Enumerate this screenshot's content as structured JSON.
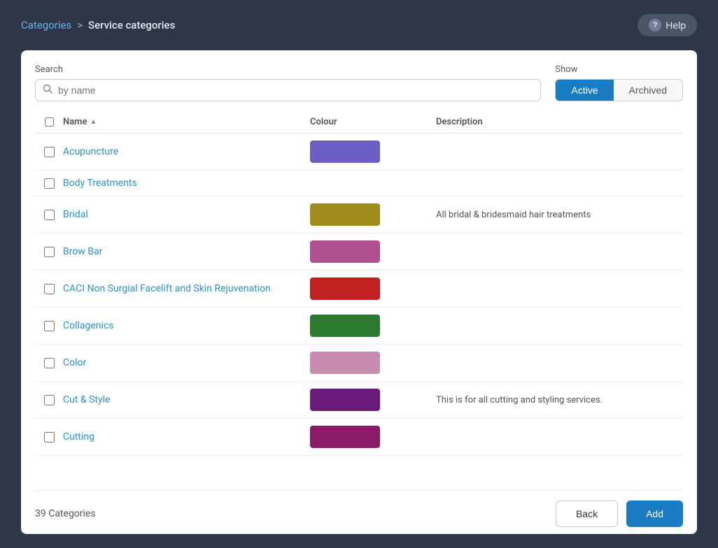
{
  "breadcrumb": {
    "parent_label": "Categories",
    "separator": ">",
    "current_label": "Service categories"
  },
  "help_button": {
    "label": "Help",
    "icon": "?"
  },
  "search": {
    "label": "Search",
    "placeholder": "by name"
  },
  "show": {
    "label": "Show",
    "options": [
      {
        "id": "active",
        "label": "Active",
        "active": true
      },
      {
        "id": "archived",
        "label": "Archived",
        "active": false
      }
    ]
  },
  "table": {
    "columns": [
      {
        "id": "check",
        "label": ""
      },
      {
        "id": "name",
        "label": "Name"
      },
      {
        "id": "colour",
        "label": "Colour"
      },
      {
        "id": "description",
        "label": "Description"
      }
    ],
    "rows": [
      {
        "id": 1,
        "name": "Acupuncture",
        "color": "#6b5fc4",
        "description": ""
      },
      {
        "id": 2,
        "name": "Body Treatments",
        "color": "",
        "description": ""
      },
      {
        "id": 3,
        "name": "Bridal",
        "color": "#a08c1a",
        "description": "All bridal & bridesmaid hair treatments"
      },
      {
        "id": 4,
        "name": "Brow Bar",
        "color": "#b05090",
        "description": ""
      },
      {
        "id": 5,
        "name": "CACI Non Surgial Facelift and Skin Rejuvenation",
        "color": "#c02020",
        "description": ""
      },
      {
        "id": 6,
        "name": "Collagenics",
        "color": "#2a7a30",
        "description": ""
      },
      {
        "id": 7,
        "name": "Color",
        "color": "#c88cb0",
        "description": ""
      },
      {
        "id": 8,
        "name": "Cut & Style",
        "color": "#6a1a7a",
        "description": "This is for all cutting and styling services."
      },
      {
        "id": 9,
        "name": "Cutting",
        "color": "#8a1a6a",
        "description": ""
      }
    ]
  },
  "footer": {
    "count_label": "39 Categories",
    "back_label": "Back",
    "add_label": "Add"
  }
}
